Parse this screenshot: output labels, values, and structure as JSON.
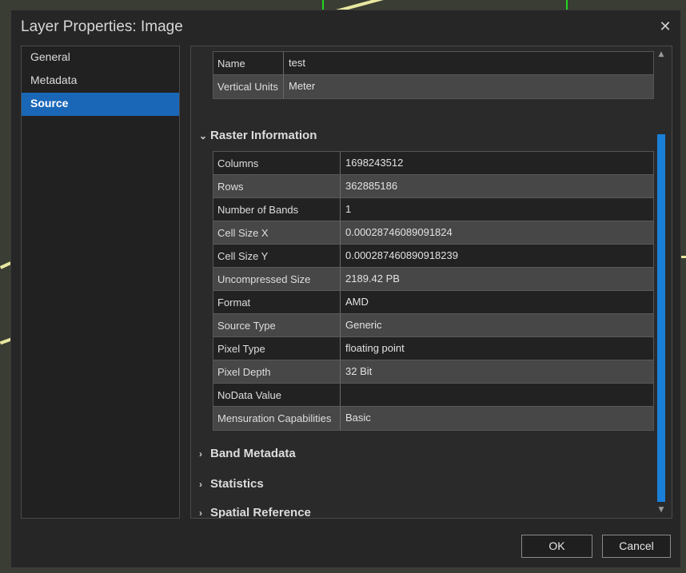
{
  "window": {
    "title": "Layer Properties: Image",
    "close_glyph": "✕"
  },
  "sidebar": {
    "items": [
      {
        "label": "General"
      },
      {
        "label": "Metadata"
      },
      {
        "label": "Source"
      }
    ]
  },
  "top_table": [
    {
      "key": "Name",
      "value": "test"
    },
    {
      "key": "Vertical Units",
      "value": "Meter"
    }
  ],
  "sections": {
    "raster": "Raster Information",
    "band": "Band Metadata",
    "statistics": "Statistics",
    "spatial": "Spatial Reference"
  },
  "raster_table": [
    {
      "key": "Columns",
      "value": "1698243512"
    },
    {
      "key": "Rows",
      "value": "362885186"
    },
    {
      "key": "Number of Bands",
      "value": "1"
    },
    {
      "key": "Cell Size X",
      "value": "0.00028746089091824"
    },
    {
      "key": "Cell Size Y",
      "value": "0.000287460890918239"
    },
    {
      "key": "Uncompressed Size",
      "value": "2189.42 PB"
    },
    {
      "key": "Format",
      "value": "AMD"
    },
    {
      "key": "Source Type",
      "value": "Generic"
    },
    {
      "key": "Pixel Type",
      "value": "floating point"
    },
    {
      "key": "Pixel Depth",
      "value": "32 Bit"
    },
    {
      "key": "NoData Value",
      "value": ""
    },
    {
      "key": "Mensuration Capabilities",
      "value": "Basic"
    }
  ],
  "buttons": {
    "ok": "OK",
    "cancel": "Cancel"
  },
  "colors": {
    "accent": "#1a67b8",
    "scrollbar": "#1a7fd8"
  }
}
